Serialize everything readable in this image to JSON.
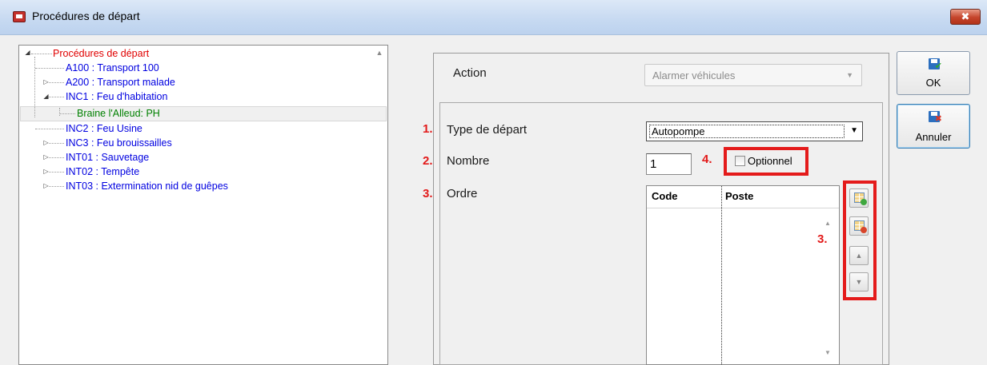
{
  "window": {
    "title": "Procédures de départ",
    "close_label": "✖"
  },
  "tree": {
    "root": "Procédures de départ",
    "items": [
      "A100 : Transport 100",
      "A200 : Transport malade",
      "INC1 : Feu d'habitation",
      "Braine l'Alleud: PH",
      "INC2 : Feu  Usine",
      "INC3 : Feu brouissailles",
      "INT01 : Sauvetage",
      "INT02 : Tempête",
      "INT03 : Extermination nid de guêpes"
    ]
  },
  "form": {
    "action_label": "Action",
    "action_value": "Alarmer véhicules",
    "type_label": "Type de départ",
    "type_value": "Autopompe",
    "nombre_label": "Nombre",
    "nombre_value": "1",
    "optionnel_label": "Optionnel",
    "optionnel_checked": false,
    "ordre_label": "Ordre",
    "grid_columns": [
      "Code",
      "Poste"
    ]
  },
  "annotations": [
    "1.",
    "2.",
    "3.",
    "4.",
    "3."
  ],
  "buttons": {
    "ok": "OK",
    "cancel": "Annuler"
  },
  "colors": {
    "annotation_red": "#e41b1b",
    "tree_root": "#e00000",
    "tree_item": "#0000e0",
    "tree_leaf": "#008000"
  }
}
